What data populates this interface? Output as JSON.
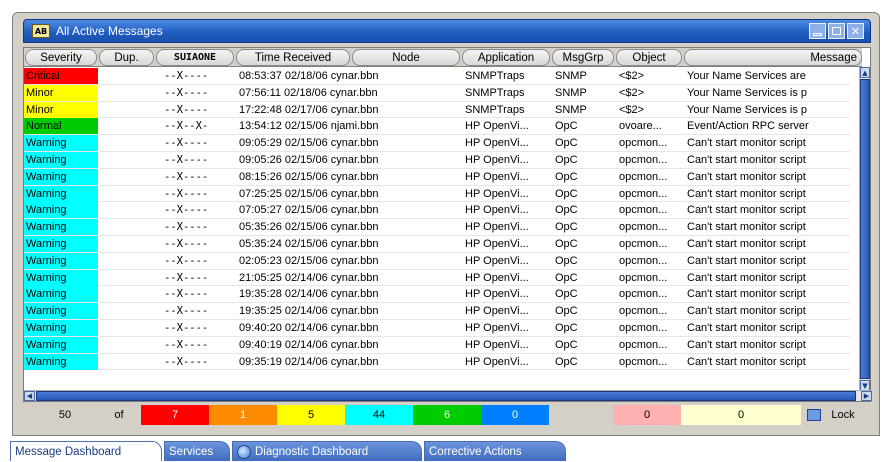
{
  "window": {
    "title": "All Active Messages",
    "title_icon_text": "AB"
  },
  "columns": [
    {
      "label": "Severity"
    },
    {
      "label": "Dup."
    },
    {
      "label": "SUIAONE"
    },
    {
      "label": "Time Received"
    },
    {
      "label": "Node"
    },
    {
      "label": "Application"
    },
    {
      "label": "MsgGrp"
    },
    {
      "label": "Object"
    },
    {
      "label": "Message"
    }
  ],
  "severity_colors": {
    "Critical": "#ff0000",
    "Minor": "#ffff00",
    "Normal": "#00cc00",
    "Warning": "#00ffff"
  },
  "rows": [
    {
      "severity": "Critical",
      "dup": "",
      "flags": "--X----",
      "time": "08:53:37 02/18/06 cynar.bbn",
      "app": "SNMPTraps",
      "grp": "SNMP",
      "obj": "<$2>",
      "msg": "Your Name Services are"
    },
    {
      "severity": "Minor",
      "dup": "",
      "flags": "--X----",
      "time": "07:56:11 02/18/06 cynar.bbn",
      "app": "SNMPTraps",
      "grp": "SNMP",
      "obj": "<$2>",
      "msg": "Your Name Services is p"
    },
    {
      "severity": "Minor",
      "dup": "",
      "flags": "--X----",
      "time": "17:22:48 02/17/06 cynar.bbn",
      "app": "SNMPTraps",
      "grp": "SNMP",
      "obj": "<$2>",
      "msg": "Your Name Services is p"
    },
    {
      "severity": "Normal",
      "dup": "",
      "flags": "--X--X-",
      "time": "13:54:12 02/15/06 njami.bbn",
      "app": "HP OpenVi...",
      "grp": "OpC",
      "obj": "ovoare...",
      "msg": "Event/Action RPC server"
    },
    {
      "severity": "Warning",
      "dup": "",
      "flags": "--X----",
      "time": "09:05:29 02/15/06 cynar.bbn",
      "app": "HP OpenVi...",
      "grp": "OpC",
      "obj": "opcmon...",
      "msg": "Can't start monitor script"
    },
    {
      "severity": "Warning",
      "dup": "",
      "flags": "--X----",
      "time": "09:05:26 02/15/06 cynar.bbn",
      "app": "HP OpenVi...",
      "grp": "OpC",
      "obj": "opcmon...",
      "msg": "Can't start monitor script"
    },
    {
      "severity": "Warning",
      "dup": "",
      "flags": "--X----",
      "time": "08:15:26 02/15/06 cynar.bbn",
      "app": "HP OpenVi...",
      "grp": "OpC",
      "obj": "opcmon...",
      "msg": "Can't start monitor script"
    },
    {
      "severity": "Warning",
      "dup": "",
      "flags": "--X----",
      "time": "07:25:25 02/15/06 cynar.bbn",
      "app": "HP OpenVi...",
      "grp": "OpC",
      "obj": "opcmon...",
      "msg": "Can't start monitor script"
    },
    {
      "severity": "Warning",
      "dup": "",
      "flags": "--X----",
      "time": "07:05:27 02/15/06 cynar.bbn",
      "app": "HP OpenVi...",
      "grp": "OpC",
      "obj": "opcmon...",
      "msg": "Can't start monitor script"
    },
    {
      "severity": "Warning",
      "dup": "",
      "flags": "--X----",
      "time": "05:35:26 02/15/06 cynar.bbn",
      "app": "HP OpenVi...",
      "grp": "OpC",
      "obj": "opcmon...",
      "msg": "Can't start monitor script"
    },
    {
      "severity": "Warning",
      "dup": "",
      "flags": "--X----",
      "time": "05:35:24 02/15/06 cynar.bbn",
      "app": "HP OpenVi...",
      "grp": "OpC",
      "obj": "opcmon...",
      "msg": "Can't start monitor script"
    },
    {
      "severity": "Warning",
      "dup": "",
      "flags": "--X----",
      "time": "02:05:23 02/15/06 cynar.bbn",
      "app": "HP OpenVi...",
      "grp": "OpC",
      "obj": "opcmon...",
      "msg": "Can't start monitor script"
    },
    {
      "severity": "Warning",
      "dup": "",
      "flags": "--X----",
      "time": "21:05:25 02/14/06 cynar.bbn",
      "app": "HP OpenVi...",
      "grp": "OpC",
      "obj": "opcmon...",
      "msg": "Can't start monitor script"
    },
    {
      "severity": "Warning",
      "dup": "",
      "flags": "--X----",
      "time": "19:35:28 02/14/06 cynar.bbn",
      "app": "HP OpenVi...",
      "grp": "OpC",
      "obj": "opcmon...",
      "msg": "Can't start monitor script"
    },
    {
      "severity": "Warning",
      "dup": "",
      "flags": "--X----",
      "time": "19:35:25 02/14/06 cynar.bbn",
      "app": "HP OpenVi...",
      "grp": "OpC",
      "obj": "opcmon...",
      "msg": "Can't start monitor script"
    },
    {
      "severity": "Warning",
      "dup": "",
      "flags": "--X----",
      "time": "09:40:20 02/14/06 cynar.bbn",
      "app": "HP OpenVi...",
      "grp": "OpC",
      "obj": "opcmon...",
      "msg": "Can't start monitor script"
    },
    {
      "severity": "Warning",
      "dup": "",
      "flags": "--X----",
      "time": "09:40:19 02/14/06 cynar.bbn",
      "app": "HP OpenVi...",
      "grp": "OpC",
      "obj": "opcmon...",
      "msg": "Can't start monitor script"
    },
    {
      "severity": "Warning",
      "dup": "",
      "flags": "--X----",
      "time": "09:35:19 02/14/06 cynar.bbn",
      "app": "HP OpenVi...",
      "grp": "OpC",
      "obj": "opcmon...",
      "msg": "Can't start monitor script"
    }
  ],
  "status": {
    "total": "50",
    "of_label": "of",
    "counts": [
      {
        "value": "7",
        "color": "#ff0000"
      },
      {
        "value": "1",
        "color": "#ff8c00"
      },
      {
        "value": "5",
        "color": "#ffff00"
      },
      {
        "value": "44",
        "color": "#00ffff"
      },
      {
        "value": "6",
        "color": "#00cc00"
      },
      {
        "value": "0",
        "color": "#0080ff"
      },
      {
        "value": "0",
        "color": "#ffb0b0"
      },
      {
        "value": "0",
        "color": "#ffffd0"
      }
    ],
    "lock_label": "Lock"
  },
  "tabs": [
    {
      "label": "Message Dashboard"
    },
    {
      "label": "Services"
    },
    {
      "label": "Diagnostic Dashboard"
    },
    {
      "label": "Corrective Actions"
    }
  ]
}
